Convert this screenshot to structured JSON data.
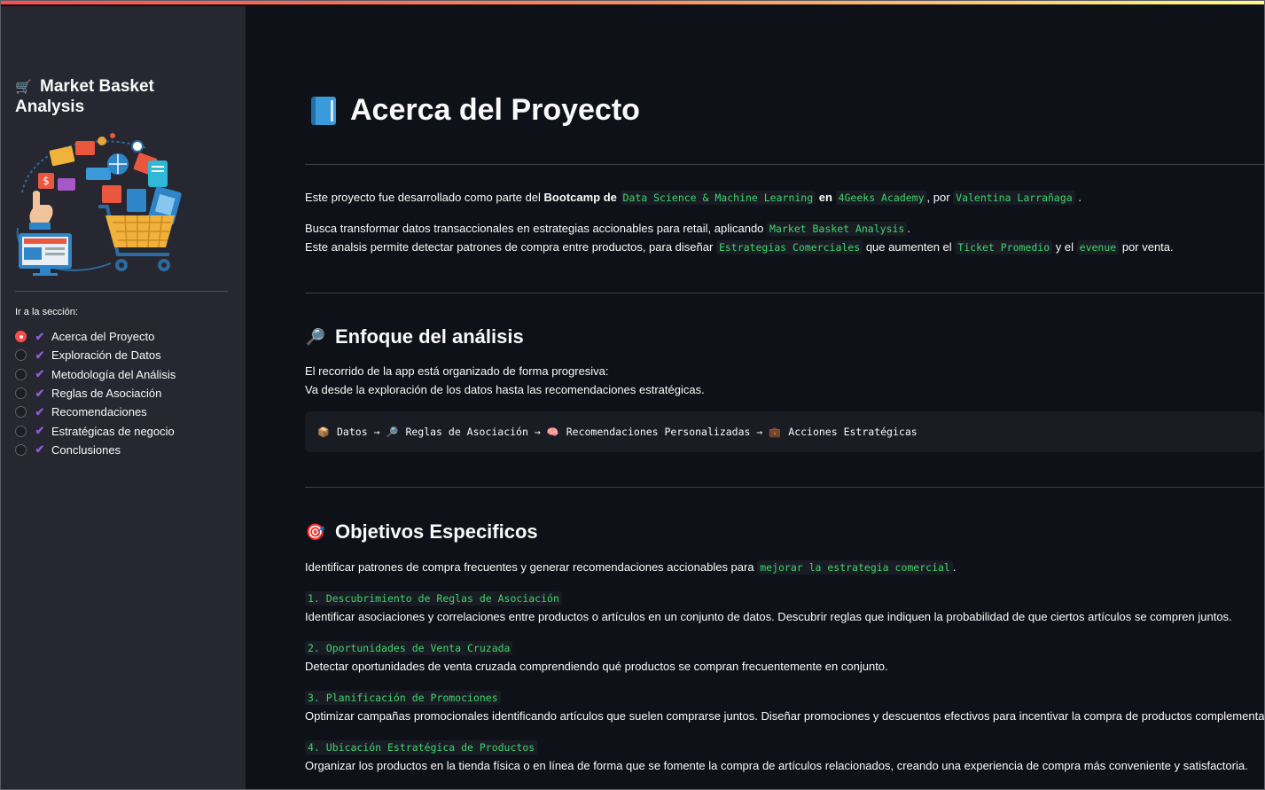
{
  "sidebar": {
    "title": "Market Basket Analysis",
    "title_icon": "shopping-cart-icon",
    "radio_label": "Ir a la sección:",
    "items": [
      {
        "label": "Acerca del Proyecto",
        "selected": true
      },
      {
        "label": "Exploración de Datos",
        "selected": false
      },
      {
        "label": "Metodología del Análisis",
        "selected": false
      },
      {
        "label": "Reglas de Asociación",
        "selected": false
      },
      {
        "label": "Recomendaciones",
        "selected": false
      },
      {
        "label": "Estratégicas de negocio",
        "selected": false
      },
      {
        "label": "Conclusiones",
        "selected": false
      }
    ]
  },
  "main": {
    "title": "Acerca del Proyecto",
    "title_icon": "book-icon",
    "intro": {
      "p1_a": "Este proyecto fue desarrollado como parte del ",
      "p1_bold1": "Bootcamp de",
      "p1_code1": "Data Science & Machine Learning",
      "p1_bold2": "en",
      "p1_code2": "4Geeks Academy",
      "p1_b": ", por",
      "p1_code3": "Valentina Larrañaga",
      "p1_end": ".",
      "p2_a": "Busca transformar datos transaccionales en estrategias accionables para retail, aplicando",
      "p2_code": "Market Basket Analysis",
      "p2_end": ".",
      "p3_a": "Este analsis permite detectar patrones de compra entre productos, para diseñar",
      "p3_code1": "Estrategias Comerciales",
      "p3_b": "que aumenten el",
      "p3_code2": "Ticket Promedio",
      "p3_c": "y el",
      "p3_code3": "evenue",
      "p3_end": "por venta."
    },
    "enfoque": {
      "title": "Enfoque del análisis",
      "icon": "magnifier-icon",
      "line1": "El recorrido de la app está organizado de forma progresiva:",
      "line2": "Va desde la exploración de los datos hasta las recomendaciones estratégicas.",
      "flow": [
        {
          "icon": "package-icon",
          "label": "Datos"
        },
        {
          "icon": "magnifier-icon",
          "label": "Reglas de Asociación"
        },
        {
          "icon": "brain-icon",
          "label": "Recomendaciones Personalizadas"
        },
        {
          "icon": "briefcase-icon",
          "label": "Acciones Estratégicas"
        }
      ],
      "arrow": "→"
    },
    "objetivos": {
      "title": "Objetivos Especificos",
      "icon": "target-icon",
      "intro_a": "Identificar patrones de compra frecuentes y generar recomendaciones accionables para",
      "intro_code": "mejorar la estrategia comercial",
      "intro_end": ".",
      "items": [
        {
          "head": "1. Descubrimiento de Reglas de Asociación",
          "text": "Identificar asociaciones y correlaciones entre productos o artículos en un conjunto de datos. Descubrir reglas que indiquen la probabilidad de que ciertos artículos se compren juntos."
        },
        {
          "head": "2. Oportunidades de Venta Cruzada",
          "text": "Detectar oportunidades de venta cruzada comprendiendo qué productos se compran frecuentemente en conjunto."
        },
        {
          "head": "3. Planificación de Promociones",
          "text": "Optimizar campañas promocionales identificando artículos que suelen comprarse juntos. Diseñar promociones y descuentos efectivos para incentivar la compra de productos complementarios."
        },
        {
          "head": "4. Ubicación Estratégica de Productos",
          "text": "Organizar los productos en la tienda física o en línea de forma que se fomente la compra de artículos relacionados, creando una experiencia de compra más conveniente y satisfactoria."
        }
      ]
    }
  },
  "colors": {
    "accent": "#ff4b4b",
    "code_green": "#3dd56d",
    "check_purple": "#8a5cd8",
    "sidebar_bg": "#262730",
    "main_bg": "#0e1117"
  }
}
